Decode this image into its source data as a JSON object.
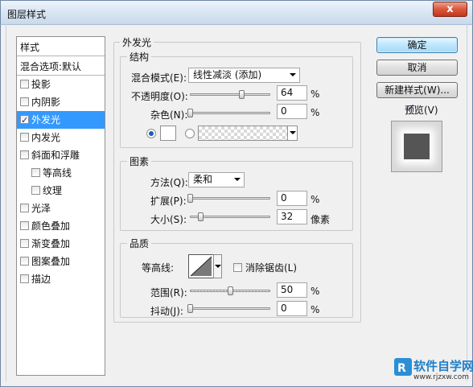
{
  "window": {
    "title": "图层样式",
    "close_glyph": "x"
  },
  "sidebar": {
    "header": "样式",
    "blend_default": "混合选项:默认",
    "items": [
      {
        "label": "投影",
        "checked": false,
        "selected": false,
        "indent": false
      },
      {
        "label": "内阴影",
        "checked": false,
        "selected": false,
        "indent": false
      },
      {
        "label": "外发光",
        "checked": true,
        "selected": true,
        "indent": false
      },
      {
        "label": "内发光",
        "checked": false,
        "selected": false,
        "indent": false
      },
      {
        "label": "斜面和浮雕",
        "checked": false,
        "selected": false,
        "indent": false
      },
      {
        "label": "等高线",
        "checked": false,
        "selected": false,
        "indent": true
      },
      {
        "label": "纹理",
        "checked": false,
        "selected": false,
        "indent": true
      },
      {
        "label": "光泽",
        "checked": false,
        "selected": false,
        "indent": false
      },
      {
        "label": "颜色叠加",
        "checked": false,
        "selected": false,
        "indent": false
      },
      {
        "label": "渐变叠加",
        "checked": false,
        "selected": false,
        "indent": false
      },
      {
        "label": "图案叠加",
        "checked": false,
        "selected": false,
        "indent": false
      },
      {
        "label": "描边",
        "checked": false,
        "selected": false,
        "indent": false
      }
    ]
  },
  "panel": {
    "title": "外发光",
    "structure": {
      "title": "结构",
      "blend_mode_label": "混合模式(E):",
      "blend_mode_value": "线性减淡 (添加)",
      "opacity_label": "不透明度(O):",
      "opacity_value": "64",
      "opacity_fraction": 0.64,
      "noise_label": "杂色(N):",
      "noise_value": "0",
      "noise_fraction": 0,
      "percent": "%"
    },
    "elements": {
      "title": "图素",
      "technique_label": "方法(Q):",
      "technique_value": "柔和",
      "spread_label": "扩展(P):",
      "spread_value": "0",
      "spread_fraction": 0,
      "size_label": "大小(S):",
      "size_value": "32",
      "size_fraction": 0.13,
      "size_unit": "像素",
      "percent": "%"
    },
    "quality": {
      "title": "品质",
      "contour_label": "等高线:",
      "antialias_label": "消除锯齿(L)",
      "range_label": "范围(R):",
      "range_value": "50",
      "range_fraction": 0.5,
      "jitter_label": "抖动(J):",
      "jitter_value": "0",
      "jitter_fraction": 0,
      "percent": "%"
    }
  },
  "buttons": {
    "ok": "确定",
    "cancel": "取消",
    "new_style": "新建样式(W)...",
    "preview": "预览(V)"
  },
  "watermark": {
    "brand": "软件自学网",
    "url": "www.rjzxw.com"
  },
  "colors": {
    "selection": "#3399ff",
    "glow_swatch": "#ffffff",
    "preview_square": "#555555"
  }
}
